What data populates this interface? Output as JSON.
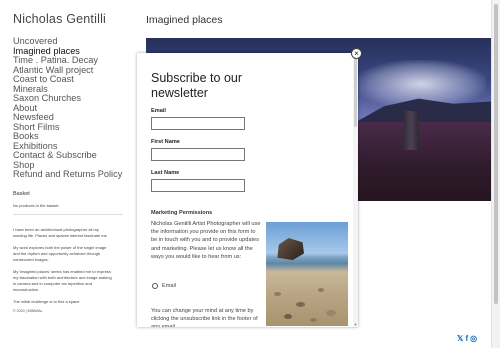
{
  "site": {
    "title": "Nicholas Gentilli"
  },
  "nav": [
    "Uncovered",
    "Imagined places",
    "Time . Patina. Decay",
    "Atlantic Wall project",
    "Coast to Coast",
    "Minerals",
    "Saxon Churches",
    "About",
    "Newsfeed",
    "Short Films",
    "Books",
    "Exhibitions",
    "Contact & Subscribe",
    "Shop",
    "Refund and Returns Policy"
  ],
  "active_nav": "Imagined places",
  "basket": {
    "title": "Basket",
    "empty_text": "No products in the basket."
  },
  "about": [
    "I have been an architectural photographer all my working life. Places and spaces interest fascinate me",
    "My work explores both the power of the single image and the rhythm and opportunity achieved through constructed images.",
    "My 'imagined places' series has enabled me to express my fascination with both architecture and image-making in camera and in computer via repetition and reconstruction.",
    "The initial challenge is to find a space"
  ],
  "copyright": "© 2020 | MINIMAL",
  "page": {
    "heading": "Imagined places"
  },
  "modal": {
    "title": "Subscribe to our newsletter",
    "close_glyph": "×",
    "fields": [
      {
        "label": "Email",
        "value": ""
      },
      {
        "label": "First Name",
        "value": ""
      },
      {
        "label": "Last Name",
        "value": ""
      }
    ],
    "permissions_title": "Marketing Permissions",
    "permissions_text": "Nicholas Gentilli Artist Photographer will use the information you provide on this form to be in touch with you and to provide updates and marketing. Please let us know all the ways you would like to hear from us:",
    "email_option": "Email",
    "change_text": "You can change your mind at any time by clicking the unsubscribe link in the footer of any email"
  },
  "social": {
    "twitter": "𝕏",
    "facebook": "f",
    "instagram": "◎"
  },
  "colors": {
    "social": "#1d6fb8",
    "hero_sky": "#3c4a84",
    "hero_ground": "#2e1a2b"
  }
}
